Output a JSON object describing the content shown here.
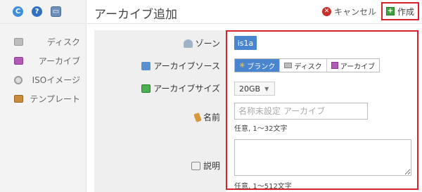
{
  "sidebar": {
    "toolbar": [
      {
        "name": "refresh-icon",
        "glyph": "C"
      },
      {
        "name": "help-icon",
        "glyph": "?"
      },
      {
        "name": "console-icon",
        "glyph": "▭"
      }
    ],
    "items": [
      {
        "label": "ディスク",
        "icon": "disk-icon"
      },
      {
        "label": "アーカイブ",
        "icon": "archive-icon"
      },
      {
        "label": "ISOイメージ",
        "icon": "iso-image-icon"
      },
      {
        "label": "テンプレート",
        "icon": "template-icon"
      }
    ]
  },
  "header": {
    "title": "アーカイブ追加",
    "cancel_label": "キャンセル",
    "create_label": "作成"
  },
  "form": {
    "zone": {
      "label": "ゾーン",
      "value": "is1a"
    },
    "source": {
      "label": "アーカイブソース",
      "options": [
        "ブランク",
        "ディスク",
        "アーカイブ"
      ],
      "selected": "ブランク"
    },
    "size": {
      "label": "アーカイブサイズ",
      "value": "20GB"
    },
    "name": {
      "label": "名前",
      "placeholder": "名称未設定 アーカイブ",
      "value": "",
      "hint": "任意, 1〜32文字"
    },
    "description": {
      "label": "説明",
      "value": "",
      "hint": "任意, 1〜512文字"
    }
  },
  "colors": {
    "accent": "#4a86cf",
    "highlight": "#d9222a",
    "create_green": "#3fa33f",
    "cancel_red": "#c9302c"
  }
}
